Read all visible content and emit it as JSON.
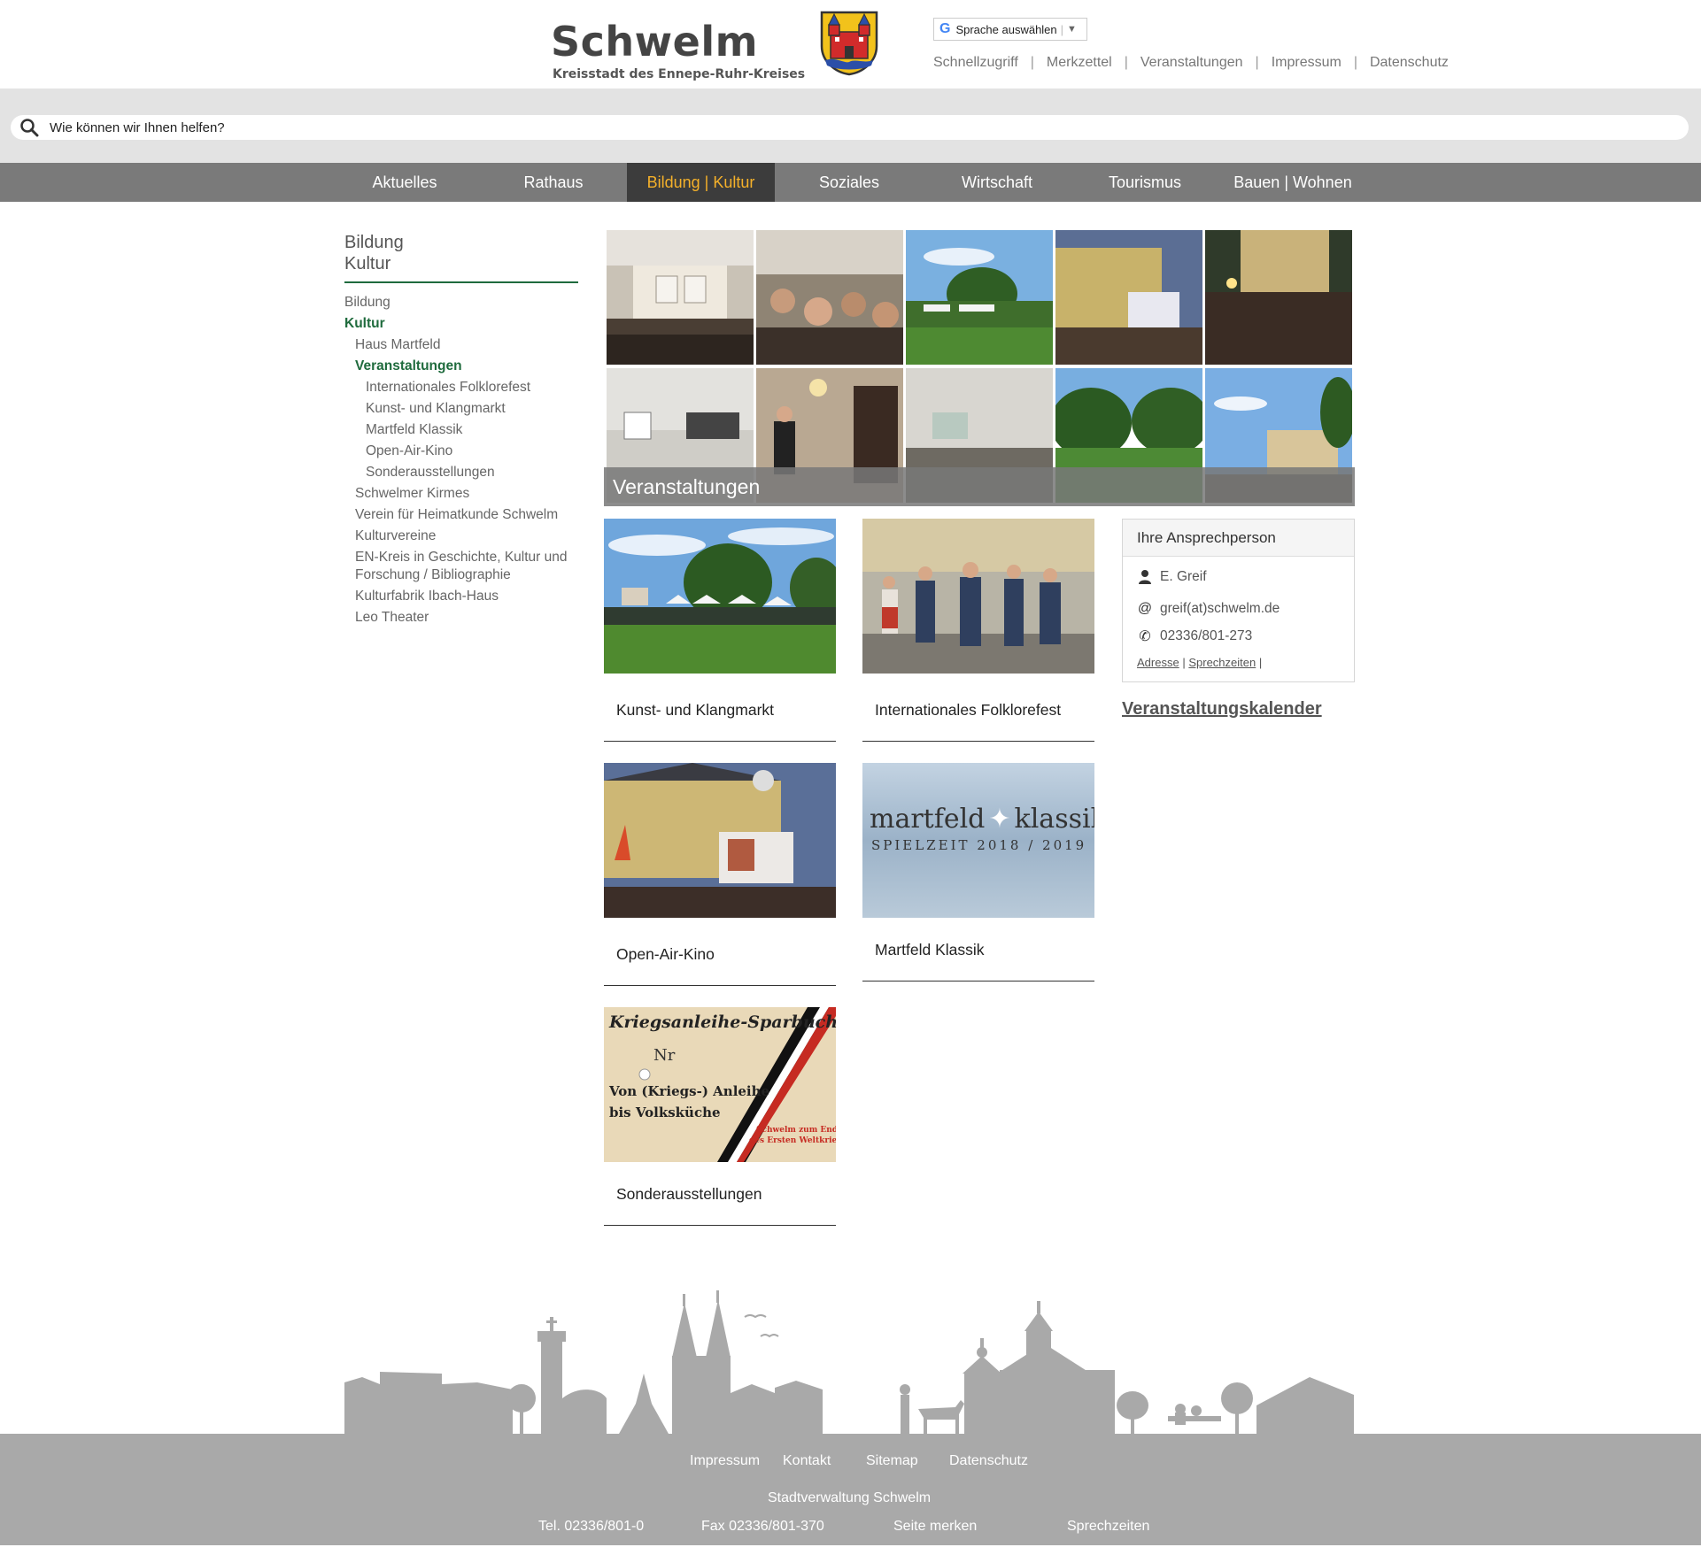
{
  "header": {
    "logo_title": "Schwelm",
    "logo_subtitle": "Kreisstadt des Ennepe-Ruhr-Kreises",
    "language_select": "Sprache auswählen",
    "top_links": [
      "Schnellzugriff",
      "Merkzettel",
      "Veranstaltungen",
      "Impressum",
      "Datenschutz"
    ]
  },
  "search": {
    "placeholder": "Wie können wir Ihnen helfen?"
  },
  "nav": {
    "items": [
      "Aktuelles",
      "Rathaus",
      "Bildung | Kultur",
      "Soziales",
      "Wirtschaft",
      "Tourismus",
      "Bauen | Wohnen"
    ],
    "active": "Bildung | Kultur",
    "active_color": "#f5b12a"
  },
  "sidebar": {
    "title_line1": "Bildung",
    "title_line2": "Kultur",
    "items": [
      {
        "label": "Bildung",
        "level": 0,
        "current": false
      },
      {
        "label": "Kultur",
        "level": 0,
        "current": true
      },
      {
        "label": "Haus Martfeld",
        "level": 1,
        "current": false
      },
      {
        "label": "Veranstaltungen",
        "level": 1,
        "current": true
      },
      {
        "label": "Internationales Folklorefest",
        "level": 2,
        "current": false
      },
      {
        "label": "Kunst- und Klangmarkt",
        "level": 2,
        "current": false
      },
      {
        "label": "Martfeld Klassik",
        "level": 2,
        "current": false
      },
      {
        "label": "Open-Air-Kino",
        "level": 2,
        "current": false
      },
      {
        "label": "Sonderausstellungen",
        "level": 2,
        "current": false
      },
      {
        "label": "Schwelmer Kirmes",
        "level": 1,
        "current": false
      },
      {
        "label": "Verein für Heimatkunde Schwelm",
        "level": 1,
        "current": false
      },
      {
        "label": "Kulturvereine",
        "level": 1,
        "current": false
      },
      {
        "label": "EN-Kreis in Geschichte, Kultur und Forschung / Bibliographie",
        "level": 1,
        "current": false
      },
      {
        "label": "Kulturfabrik Ibach-Haus",
        "level": 1,
        "current": false
      },
      {
        "label": "Leo Theater",
        "level": 1,
        "current": false
      }
    ],
    "accent_color": "#1f6b3d"
  },
  "hero": {
    "caption": "Veranstaltungen"
  },
  "tiles": [
    {
      "label": "Kunst- und Klangmarkt"
    },
    {
      "label": "Internationales Folklorefest"
    },
    {
      "label": "Open-Air-Kino"
    },
    {
      "label": "Martfeld Klassik",
      "image_text_1": "martfeld",
      "image_text_2": "klassik",
      "image_text_3": "SPIELZEIT 2018 / 2019"
    },
    {
      "label": "Sonderausstellungen",
      "image_text_1": "Kriegsanleihe-Sparbuch",
      "image_text_2": "Von (Kriegs-) Anleihe",
      "image_text_3": "bis Volksküche",
      "image_text_4": "Schwelm zum Ende",
      "image_text_5": "des Ersten Weltkriegs",
      "image_text_6": "Nr"
    }
  ],
  "contact": {
    "heading": "Ihre Ansprechperson",
    "name": "E. Greif",
    "email": "greif(at)schwelm.de",
    "phone": "02336/801-273",
    "link_address": "Adresse",
    "link_hours": "Sprechzeiten",
    "separator": "|"
  },
  "calendar_link": "Veranstaltungskalender",
  "footer": {
    "links": [
      "Impressum",
      "Kontakt",
      "Sitemap",
      "Datenschutz"
    ],
    "org": "Stadtverwaltung Schwelm",
    "tel": "Tel. 02336/801-0",
    "fax": "Fax 02336/801-370",
    "bookmark": "Seite merken",
    "hours": "Sprechzeiten",
    "background": "#a9a9a9"
  }
}
